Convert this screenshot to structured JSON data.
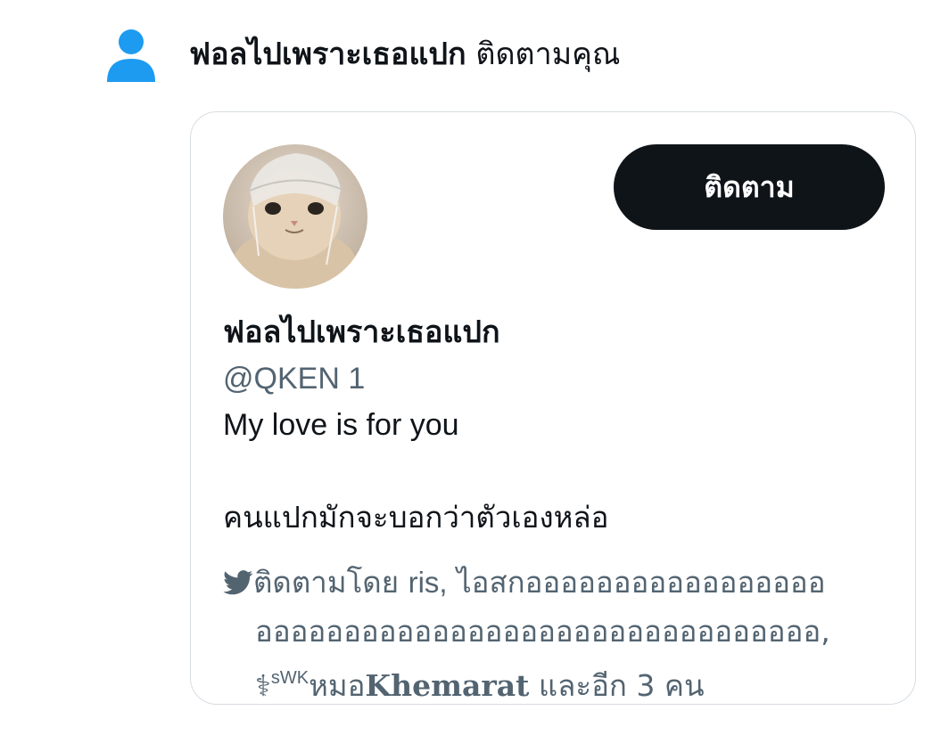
{
  "notification": {
    "follower_name": "ฟอลไปเพราะเธอแปก",
    "action_text": "ติดตามคุณ",
    "icon": "person-icon",
    "icon_color": "#1d9bf0"
  },
  "card": {
    "follow_button_label": "ติดตาม",
    "display_name": "ฟอลไปเพราะเธอแปก",
    "handle": "@QKEN 1",
    "bio_line_1": "My love is for you",
    "bio_line_2": "คนแปกมักจะบอกว่าตัวเองหล่อ",
    "followed_by": {
      "icon": "twitter-bird-icon",
      "prefix": "ติดตามโดย",
      "user1": "ris,",
      "user2_part1": "ไอสกอออออออออออออออออ",
      "user2_part2": "ออออออออออออออออออออออออออออออออ,",
      "user3_emoji": "⚕",
      "user3_sup": "sWK",
      "user3_thai": "หมอ",
      "user3_name": "Khemarat",
      "suffix": "และอีก 3 คน"
    }
  },
  "colors": {
    "button_bg": "#0f1419",
    "secondary_text": "#536471",
    "border": "#d7dde2"
  }
}
